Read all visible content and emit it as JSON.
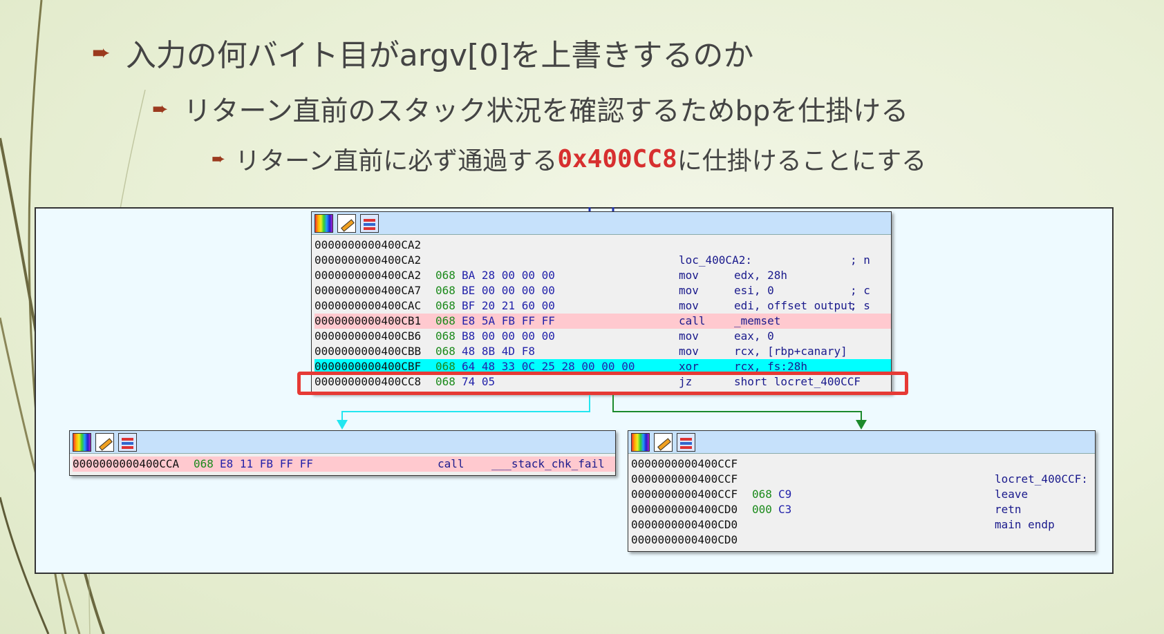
{
  "slide": {
    "bullet1": "入力の何バイト目がargv[0]を上書きするのか",
    "bullet2": "リターン直前のスタック状況を確認するためbpを仕掛ける",
    "bullet3_prefix": "リターン直前に必ず通過する",
    "bullet3_highlight": "0x400CC8",
    "bullet3_suffix": "に仕掛けることにする",
    "arrow_glyph": "➨"
  },
  "colors": {
    "accent_red": "#d72f2f",
    "bullet_arrow": "#9b3a1e",
    "call_highlight": "#ffc9cf",
    "current_highlight": "#00ffff",
    "block_header": "#c6e1fb"
  },
  "toolbar_icons": [
    "color-palette-icon",
    "edit-icon",
    "graph-icon"
  ],
  "block_top": {
    "lines": [
      {
        "addr": "0000000000400CA2",
        "seg": "",
        "bytes": "",
        "mn": "",
        "op": "",
        "cmt": ""
      },
      {
        "addr": "0000000000400CA2",
        "seg": "",
        "bytes": "",
        "mn": "loc_400CA2:",
        "op": "",
        "cmt": "; n"
      },
      {
        "addr": "0000000000400CA2",
        "seg": "068",
        "bytes": "BA 28 00 00 00",
        "mn": "mov",
        "op": "edx, 28h",
        "cmt": ""
      },
      {
        "addr": "0000000000400CA7",
        "seg": "068",
        "bytes": "BE 00 00 00 00",
        "mn": "mov",
        "op": "esi, 0",
        "cmt": "; c"
      },
      {
        "addr": "0000000000400CAC",
        "seg": "068",
        "bytes": "BF 20 21 60 00",
        "mn": "mov",
        "op": "edi, offset output",
        "cmt": "; s"
      },
      {
        "addr": "0000000000400CB1",
        "seg": "068",
        "bytes": "E8 5A FB FF FF",
        "mn": "call",
        "op": "_memset",
        "cmt": "",
        "hl": "pink"
      },
      {
        "addr": "0000000000400CB6",
        "seg": "068",
        "bytes": "B8 00 00 00 00",
        "mn": "mov",
        "op": "eax, 0",
        "cmt": ""
      },
      {
        "addr": "0000000000400CBB",
        "seg": "068",
        "bytes": "48 8B 4D F8",
        "mn": "mov",
        "op": "rcx, [rbp+canary]",
        "cmt": ""
      },
      {
        "addr": "0000000000400CBF",
        "seg": "068",
        "bytes": "64 48 33 0C 25 28 00 00 00",
        "mn": "xor",
        "op": "rcx, fs:28h",
        "cmt": "",
        "hl": "cyan"
      },
      {
        "addr": "0000000000400CC8",
        "seg": "068",
        "bytes": "74 05",
        "mn": "jz",
        "op": "short locret_400CCF",
        "cmt": ""
      }
    ]
  },
  "block_left": {
    "lines": [
      {
        "addr": "0000000000400CCA",
        "seg": "068",
        "bytes": "E8 11 FB FF FF",
        "mn": "call",
        "op": "___stack_chk_fail",
        "hl": "pink"
      }
    ]
  },
  "block_right": {
    "lines": [
      {
        "addr": "0000000000400CCF",
        "seg": "",
        "bytes": "",
        "mn": ""
      },
      {
        "addr": "0000000000400CCF",
        "seg": "",
        "bytes": "",
        "mn": "locret_400CCF:"
      },
      {
        "addr": "0000000000400CCF",
        "seg": "068",
        "bytes": "C9",
        "mn": "leave"
      },
      {
        "addr": "0000000000400CD0",
        "seg": "000",
        "bytes": "C3",
        "mn": "retn"
      },
      {
        "addr": "0000000000400CD0",
        "seg": "",
        "bytes": "",
        "mn": "main endp"
      },
      {
        "addr": "0000000000400CD0",
        "seg": "",
        "bytes": "",
        "mn": ""
      }
    ]
  }
}
